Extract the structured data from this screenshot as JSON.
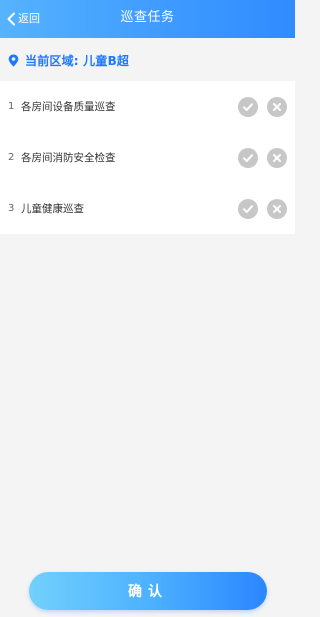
{
  "header": {
    "back_label": "返回",
    "title": "巡查任务"
  },
  "area": {
    "label": "当前区域: 儿童B超",
    "accent_color": "#1f78ff",
    "icon": "location-pin-icon"
  },
  "tasks": [
    {
      "index": "1",
      "title": "各房间设备质量巡查"
    },
    {
      "index": "2",
      "title": "各房间消防安全检查"
    },
    {
      "index": "3",
      "title": "儿童健康巡查"
    }
  ],
  "confirm": {
    "label": "确认"
  }
}
